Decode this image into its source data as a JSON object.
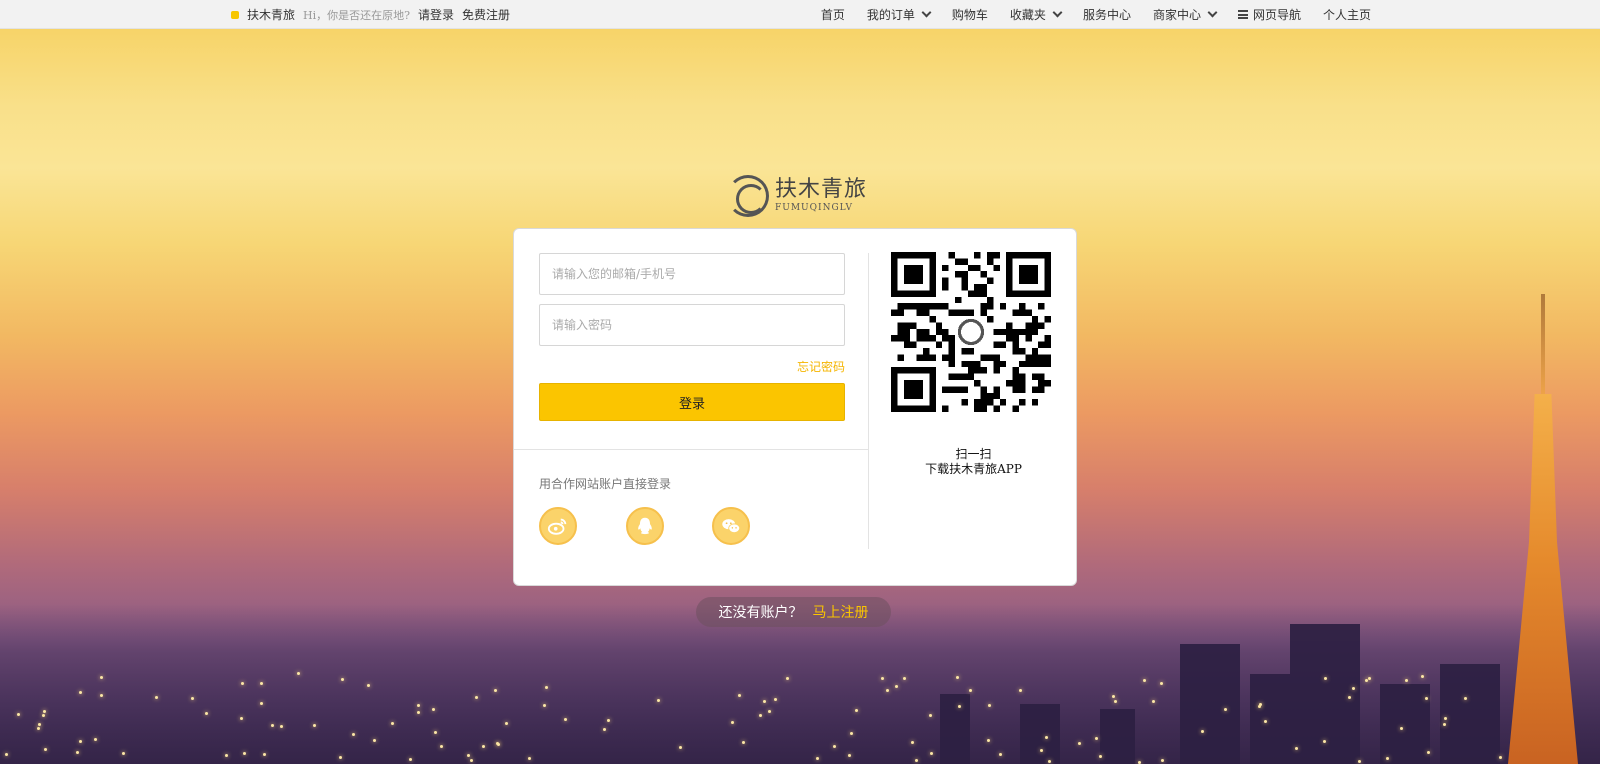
{
  "topbar": {
    "brand": "扶木青旅",
    "greeting": "Hi，你是否还在原地?",
    "login_link": "请登录",
    "register_link": "免费注册",
    "nav": {
      "home": "首页",
      "orders": "我的订单",
      "cart": "购物车",
      "favorites": "收藏夹",
      "service": "服务中心",
      "merchant": "商家中心",
      "site_nav": "网页导航",
      "profile": "个人主页"
    }
  },
  "logo": {
    "cn": "扶木青旅",
    "en": "FUMUQINGLV"
  },
  "login_form": {
    "username_placeholder": "请输入您的邮箱/手机号",
    "password_placeholder": "请输入密码",
    "forgot_password": "忘记密码",
    "submit": "登录",
    "partner_label": "用合作网站账户直接登录",
    "social": [
      "weibo-icon",
      "qq-icon",
      "wechat-icon"
    ]
  },
  "qr": {
    "line1": "扫一扫",
    "line2": "下载扶木青旅APP"
  },
  "register": {
    "prompt": "还没有账户？",
    "link": "马上注册"
  },
  "colors": {
    "accent": "#fbc500",
    "link_accent": "#f5b500"
  }
}
